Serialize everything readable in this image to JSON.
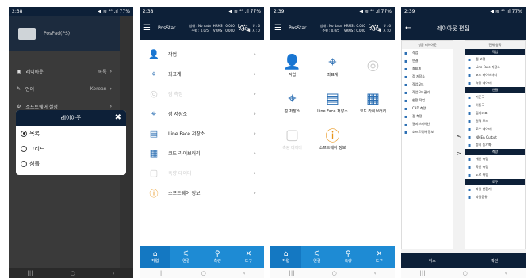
{
  "p1": {
    "status_time": "2:38",
    "status_right": "◀ ≋ ⁴⁶ .ıl 77%",
    "project_name": "PosPad(PS)",
    "menu": [
      {
        "label": "레이아웃",
        "value": "목록"
      },
      {
        "label": "언어",
        "value": "Korean"
      },
      {
        "label": "소프트웨어 설정",
        "value": ""
      }
    ],
    "dialog": {
      "title": "레이아웃",
      "close": "✖",
      "options": [
        "목록",
        "그리드",
        "심플"
      ],
      "selected_index": 0
    }
  },
  "p2": {
    "status_time": "2:38",
    "status_right": "◀ ≋ ⁴⁶ .ıl 77%",
    "app_title": "PosStar",
    "stat_l1": "상태 : No data",
    "stat_l2": "수평 : 0.0/5",
    "stat_m1": "HRMS : 0.000",
    "stat_m2": "VRMS : 0.000",
    "stat_r1": "U : 0",
    "stat_r2": "A : 0",
    "items": [
      {
        "label": "작업",
        "icon": "person-icon",
        "disabled": false
      },
      {
        "label": "좌표계",
        "icon": "coordinate-icon",
        "disabled": false
      },
      {
        "label": "점 측정",
        "icon": "satellite-icon",
        "disabled": true
      },
      {
        "label": "점 저장소",
        "icon": "map-pin-icon",
        "disabled": false
      },
      {
        "label": "Line Face 저장소",
        "icon": "folder-icon",
        "disabled": false
      },
      {
        "label": "코드 라이브러리",
        "icon": "code-library-icon",
        "disabled": false
      },
      {
        "label": "측량 데이터",
        "icon": "survey-data-icon",
        "disabled": true
      },
      {
        "label": "소프트웨어 정보",
        "icon": "info-icon",
        "disabled": false
      }
    ],
    "tabs": [
      {
        "label": "작업",
        "icon": "home-icon"
      },
      {
        "label": "연결",
        "icon": "connect-icon"
      },
      {
        "label": "측량",
        "icon": "survey-icon"
      },
      {
        "label": "도구",
        "icon": "tools-icon"
      }
    ]
  },
  "p3": {
    "status_time": "2:39",
    "status_right": "◀ ≋ ⁴⁶ .ıl 77%",
    "app_title": "PosStar",
    "stat_l1": "상태 : No data",
    "stat_l2": "수평 : 0.0/5",
    "stat_m1": "HRMS : 0.000",
    "stat_m2": "VRMS : 0.000",
    "stat_r1": "U : 0",
    "stat_r2": "A : 0",
    "grid": [
      {
        "label": "작업",
        "disabled": false
      },
      {
        "label": "좌표계",
        "disabled": false
      },
      {
        "label": "",
        "disabled": true
      },
      {
        "label": "점 저장소",
        "disabled": false
      },
      {
        "label": "Line Face 저장소",
        "disabled": false
      },
      {
        "label": "코드 라이브러리",
        "disabled": false
      },
      {
        "label": "측량 데이터",
        "disabled": true
      },
      {
        "label": "소프트웨어 정보",
        "disabled": false
      }
    ],
    "tabs": [
      {
        "label": "작업",
        "icon": "home-icon"
      },
      {
        "label": "연결",
        "icon": "connect-icon"
      },
      {
        "label": "측량",
        "icon": "survey-icon"
      },
      {
        "label": "도구",
        "icon": "tools-icon"
      }
    ]
  },
  "p4": {
    "status_time": "2:39",
    "status_right": "◀ ≋ ⁴⁶ .ıl 77%",
    "title": "레이아웃 편집",
    "left_header": "상품 레이아웃",
    "right_header": "전체 항목",
    "left_items": [
      "작업",
      "연결",
      "좌표계",
      "점 저장소",
      "작업모드",
      "작업모드관리",
      "현황 작업",
      "CAD 측량",
      "점 측정",
      "캘리브레이션",
      "소프트웨어 정보"
    ],
    "right_sections": [
      {
        "title": "작업",
        "items": [
          "점 보정",
          "Line Face 저장소",
          "코드 라이브러리",
          "측량 데이터"
        ]
      },
      {
        "title": "연결",
        "items": [
          "기준국",
          "이동국",
          "접지좌표",
          "원격 모드",
          "로우 데이터",
          "NMEA Output",
          "정시 동기화"
        ]
      },
      {
        "title": "측량",
        "items": [
          "개인 측량",
          "곡선 측량",
          "도로 측량"
        ]
      },
      {
        "title": "도구",
        "items": [
          "파일 변환기",
          "파일공유"
        ]
      }
    ],
    "cancel": "취소",
    "confirm": "확인"
  }
}
